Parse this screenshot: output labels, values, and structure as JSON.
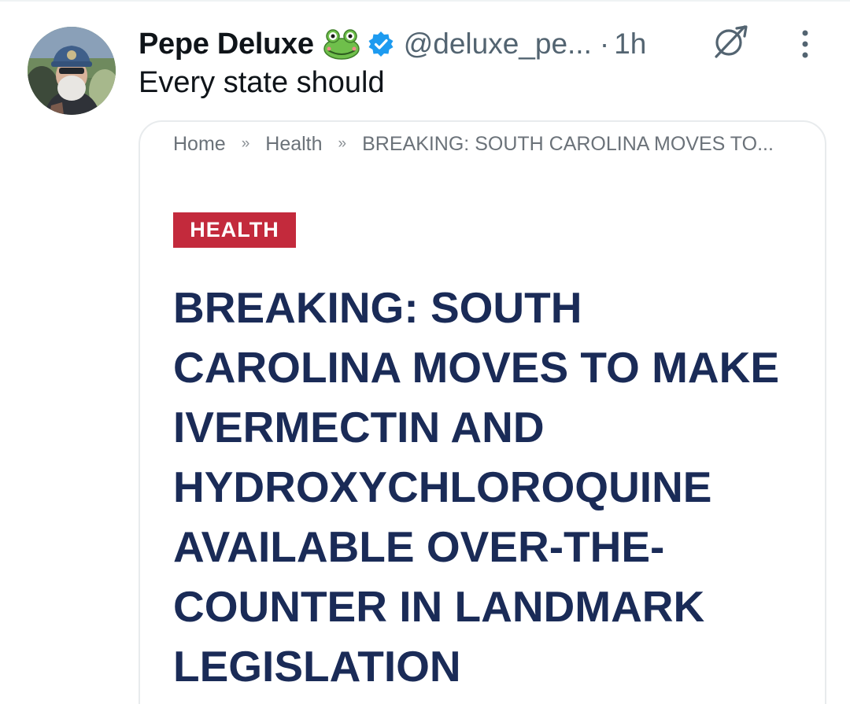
{
  "author": {
    "display_name": "Pepe Deluxe",
    "emoji": "frog-face-emoji",
    "verified": true,
    "verified_color": "#1d9bf0",
    "handle": "@deluxe_pe...",
    "dot": "·",
    "time_ago": "1h"
  },
  "icons": {
    "grok": "grok-icon",
    "more": "more-vertical-icon"
  },
  "tweet": {
    "text": "Every state should"
  },
  "card": {
    "breadcrumb": {
      "items": [
        "Home",
        "Health",
        "BREAKING: SOUTH CAROLINA MOVES TO..."
      ],
      "separator": "»"
    },
    "category": "HEALTH",
    "category_color": "#c32a3c",
    "headline": "BREAKING: SOUTH CAROLINA MOVES TO MAKE IVERMECTIN AND HYDROXYCHLOROQUINE AVAILABLE OVER-THE-COUNTER IN LANDMARK LEGISLATION",
    "headline_color": "#1a2b57"
  },
  "colors": {
    "primary_text": "#0f1419",
    "secondary_text": "#536471"
  }
}
